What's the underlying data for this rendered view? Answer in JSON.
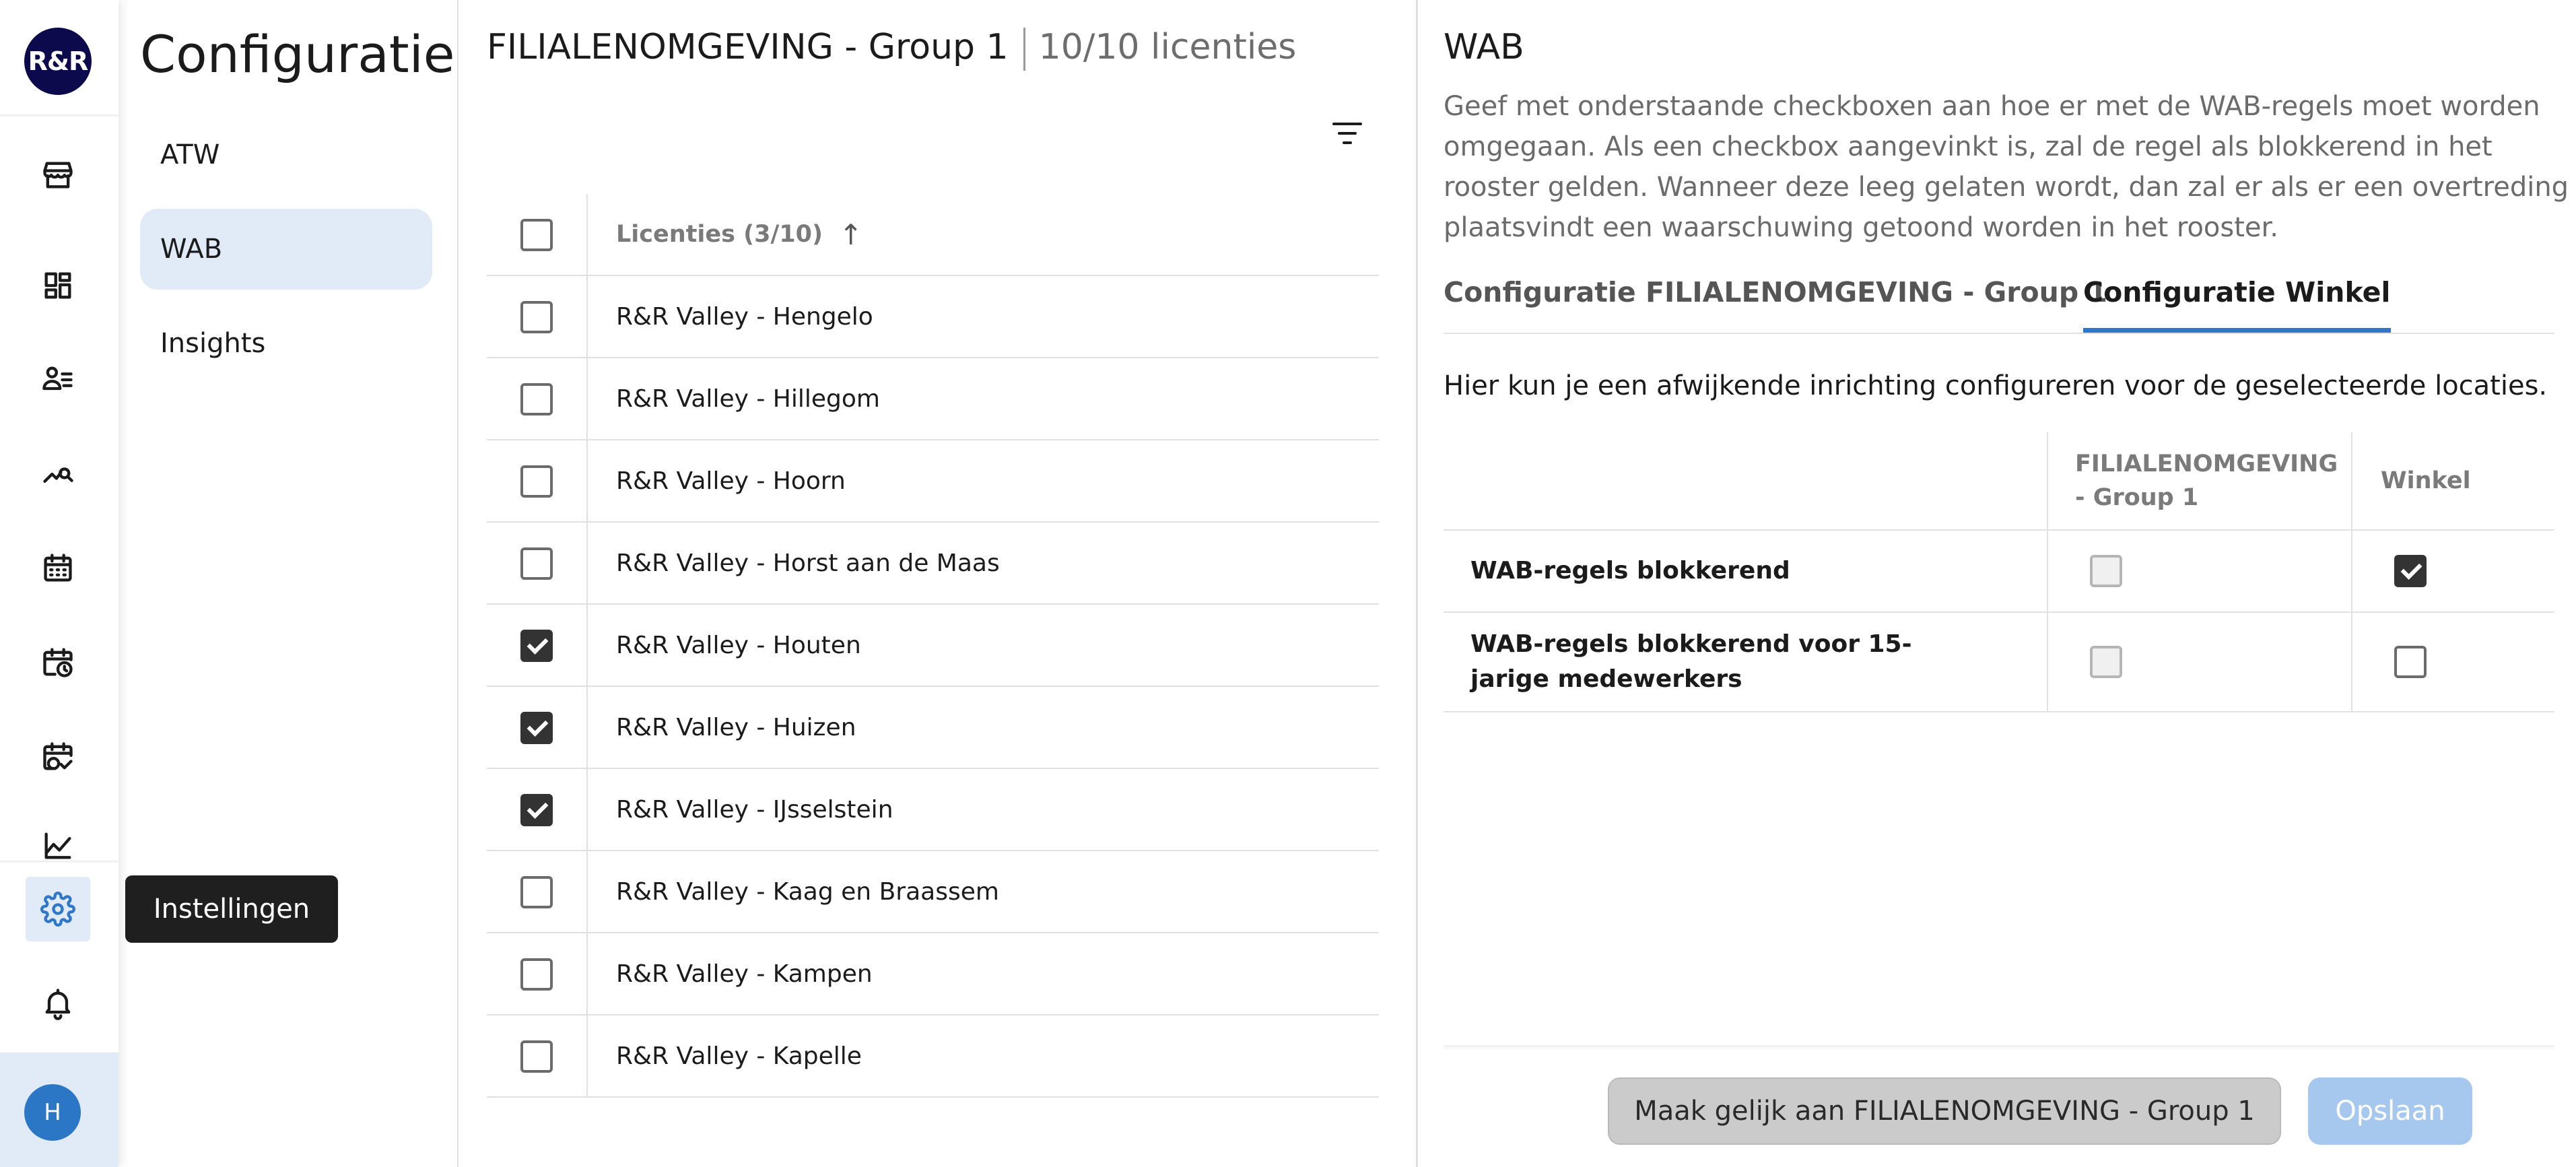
{
  "app": {
    "logo_text": "R&R",
    "user_initial": "H",
    "tooltip": "Instellingen"
  },
  "nav_icons": [
    "store-icon",
    "dashboard-icon",
    "employees-icon",
    "analytics-icon",
    "calendar-icon",
    "schedule-clock-icon",
    "schedule-check-icon",
    "chart-icon",
    "settings-icon",
    "bell-icon"
  ],
  "menu": {
    "title": "Configuratie",
    "items": [
      {
        "label": "ATW",
        "active": false
      },
      {
        "label": "WAB",
        "active": true
      },
      {
        "label": "Insights",
        "active": false
      }
    ]
  },
  "licenses": {
    "group": "FILIALENOMGEVING - Group 1",
    "count": "10/10 licenties",
    "column_header": "Licenties (3/10)",
    "sort_icon": "arrow-up-icon",
    "rows": [
      {
        "name": "R&R Valley - Hengelo",
        "checked": false
      },
      {
        "name": "R&R Valley - Hillegom",
        "checked": false
      },
      {
        "name": "R&R Valley - Hoorn",
        "checked": false
      },
      {
        "name": "R&R Valley - Horst aan de Maas",
        "checked": false
      },
      {
        "name": "R&R Valley - Houten",
        "checked": true
      },
      {
        "name": "R&R Valley - Huizen",
        "checked": true
      },
      {
        "name": "R&R Valley - IJsselstein",
        "checked": true
      },
      {
        "name": "R&R Valley - Kaag en Braassem",
        "checked": false
      },
      {
        "name": "R&R Valley - Kampen",
        "checked": false
      },
      {
        "name": "R&R Valley - Kapelle",
        "checked": false
      }
    ]
  },
  "wab": {
    "title": "WAB",
    "description": "Geef met onderstaande checkboxen aan hoe er met de WAB-regels moet worden omgegaan. Als een checkbox aangevinkt is, zal de regel als blokkerend in het rooster gelden. Wanneer deze leeg gelaten wordt, dan zal er als er een overtreding plaatsvindt een waarschuwing getoond worden in het rooster.",
    "tabs": [
      {
        "label": "Configuratie FILIALENOMGEVING - Group 1",
        "active": false
      },
      {
        "label": "Configuratie Winkel",
        "active": true
      }
    ],
    "subtitle": "Hier kun je een afwijkende inrichting configureren voor de geselecteerde locaties.",
    "table": {
      "col_group_line1": "FILIALENOMGEVING",
      "col_group_line2": "- Group 1",
      "col_winkel": "Winkel",
      "rows": [
        {
          "label": "WAB-regels blokkerend",
          "group_checked": false,
          "winkel_checked": true
        },
        {
          "label": "WAB-regels blokkerend voor 15-jarige medewerkers",
          "group_checked": false,
          "winkel_checked": false
        }
      ]
    },
    "buttons": {
      "reset": "Maak gelijk aan FILIALENOMGEVING - Group 1",
      "save": "Opslaan"
    }
  }
}
